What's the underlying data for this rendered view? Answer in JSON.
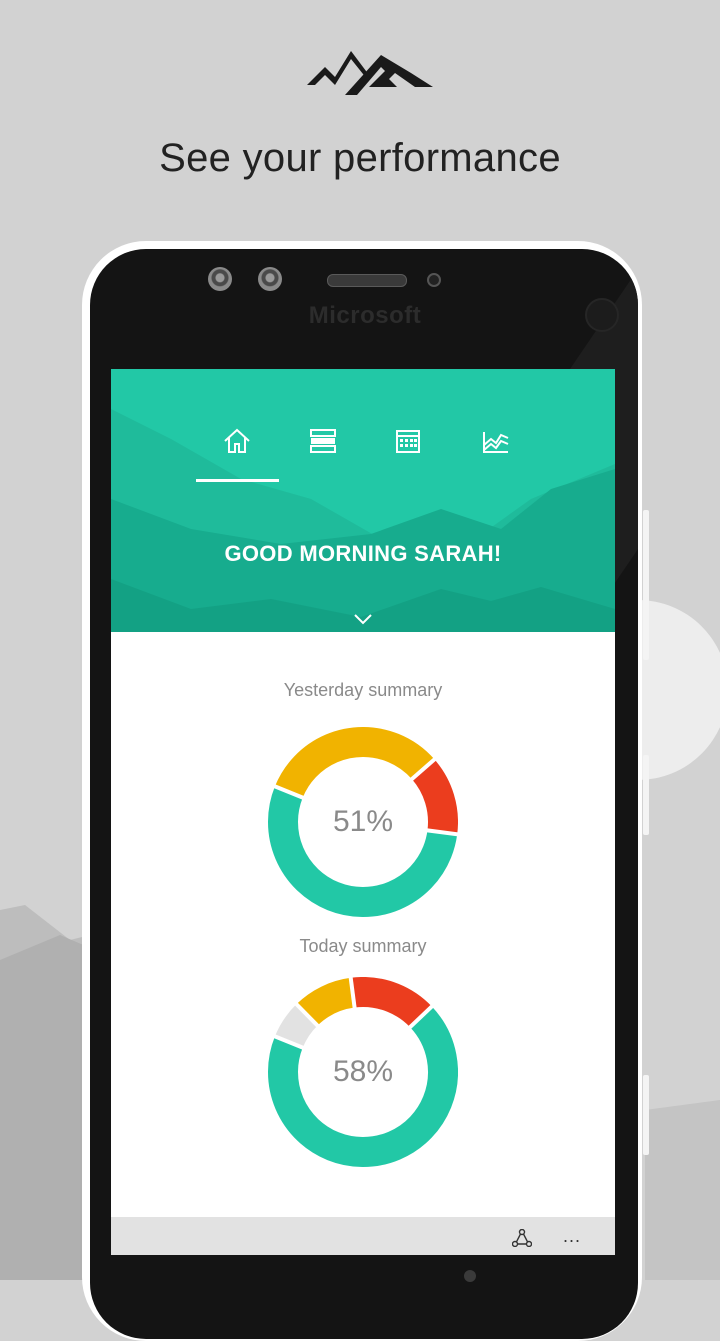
{
  "headline": "See your performance",
  "device_brand": "Microsoft",
  "app": {
    "nav": {
      "items": [
        {
          "icon": "home-icon",
          "selected": true
        },
        {
          "icon": "list-icon",
          "selected": false
        },
        {
          "icon": "calendar-icon",
          "selected": false
        },
        {
          "icon": "chart-icon",
          "selected": false
        }
      ]
    },
    "greeting": "GOOD MORNING SARAH!",
    "summaries": [
      {
        "title": "Yesterday summary",
        "percent_label": "51%",
        "segments": [
          {
            "value": 0.36,
            "color": "#f1b300"
          },
          {
            "value": 0.15,
            "color": "#eb3d1e"
          },
          {
            "value": 0.6,
            "color": "#22c8a6"
          }
        ]
      },
      {
        "title": "Today summary",
        "percent_label": "58%",
        "segments": [
          {
            "value": 0.07,
            "color": "#e2e2e2"
          },
          {
            "value": 0.11,
            "color": "#f1b300"
          },
          {
            "value": 0.16,
            "color": "#eb3d1e"
          },
          {
            "value": 0.73,
            "color": "#22c8a6"
          }
        ]
      }
    ],
    "appbar": {
      "share_icon": "share-icon",
      "more_label": "..."
    }
  },
  "colors": {
    "accent": "#22c8a6",
    "accent_dark": "#14a98a",
    "warning": "#f1b300",
    "danger": "#eb3d1e",
    "muted": "#e2e2e2"
  }
}
